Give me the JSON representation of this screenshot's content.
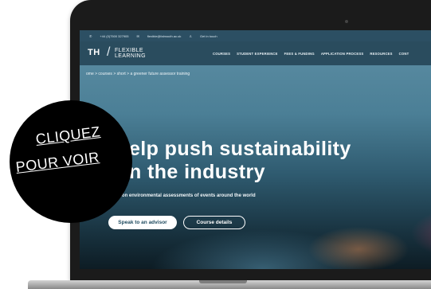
{
  "topbar": {
    "phone": "+44 (0)7500 327905",
    "email": "flexible@falmouth.ac.uk",
    "contact": "Get in touch"
  },
  "nav": {
    "logo_left": "TH",
    "logo_right_line1": "FLEXIBLE",
    "logo_right_line2": "LEARNING",
    "items": [
      "COURSES",
      "STUDENT EXPERIENCE",
      "FEES & FUNDING",
      "APPLICATION PROCESS",
      "RESOURCES",
      "CONT"
    ]
  },
  "breadcrumb": "ome > courses > short > a greener future assessor training",
  "hero": {
    "headline_line1": "elp push sustainability",
    "headline_line2": "n the industry",
    "subtitle": "Take on environmental assessments of events around the world",
    "primary_button": "Speak to an advisor",
    "secondary_button": "Course details"
  },
  "overlay": {
    "line1": "CLIQUEZ",
    "line2": "POUR VOIR"
  },
  "colors": {
    "accent_green": "#8cc63f",
    "nav_bg": "#264658",
    "overlay_bg": "#000000"
  }
}
